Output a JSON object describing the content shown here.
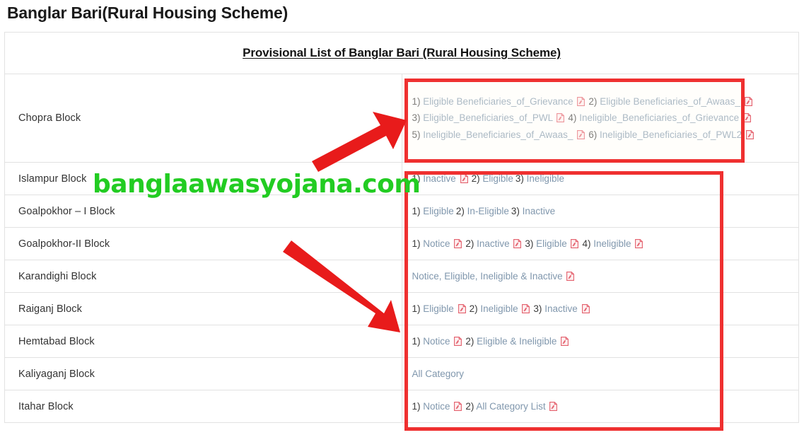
{
  "page": {
    "title": "Banglar Bari(Rural Housing Scheme)",
    "watermark": "banglaawasyojana.com"
  },
  "table": {
    "header": "Provisional List of Banglar Bari (Rural Housing Scheme)",
    "rows": [
      {
        "block": "Chopra Block",
        "lines": [
          [
            {
              "num": "1)",
              "label": "Eligible Beneficiaries_of_Grievance",
              "pdf": true
            },
            {
              "num": "2)",
              "label": "Eligible Beneficiaries_of_Awaas_",
              "pdf": true
            }
          ],
          [
            {
              "num": "3)",
              "label": "Eligible_Beneficiaries_of_PWL",
              "pdf": true
            },
            {
              "num": "4)",
              "label": "Ineligible_Beneficiaries_of_Grievance",
              "pdf": true
            }
          ],
          [
            {
              "num": "5)",
              "label": "Ineligible_Beneficiaries_of_Awaas_",
              "pdf": true
            },
            {
              "num": "6)",
              "label": "Ineligible_Beneficiaries_of_PWL2",
              "pdf": true
            }
          ]
        ]
      },
      {
        "block": "Islampur Block",
        "lines": [
          [
            {
              "num": "1)",
              "label": "Inactive",
              "pdf": true
            },
            {
              "num": "2)",
              "label": "Eligible",
              "pdf": false
            },
            {
              "num": "3)",
              "label": "Ineligible",
              "pdf": false
            }
          ]
        ]
      },
      {
        "block": "Goalpokhor – I Block",
        "lines": [
          [
            {
              "num": "1)",
              "label": "Eligible",
              "pdf": false
            },
            {
              "num": "2)",
              "label": "In-Eligible",
              "pdf": false
            },
            {
              "num": "3)",
              "label": "Inactive",
              "pdf": false
            }
          ]
        ]
      },
      {
        "block": "Goalpokhor-II Block",
        "lines": [
          [
            {
              "num": "1)",
              "label": "Notice",
              "pdf": true
            },
            {
              "num": "2)",
              "label": "Inactive",
              "pdf": true
            },
            {
              "num": "3)",
              "label": "Eligible",
              "pdf": true
            },
            {
              "num": "4)",
              "label": "Ineligible",
              "pdf": true
            }
          ]
        ]
      },
      {
        "block": "Karandighi Block",
        "lines": [
          [
            {
              "num": "",
              "label": "Notice, Eligible, Ineligible & Inactive",
              "pdf": true
            }
          ]
        ]
      },
      {
        "block": "Raiganj Block",
        "lines": [
          [
            {
              "num": "1)",
              "label": "Eligible",
              "pdf": true
            },
            {
              "num": "2)",
              "label": "Ineligible",
              "pdf": true
            },
            {
              "num": "3)",
              "label": "Inactive",
              "pdf": true
            }
          ]
        ]
      },
      {
        "block": "Hemtabad Block",
        "lines": [
          [
            {
              "num": "1)",
              "label": "Notice",
              "pdf": true
            },
            {
              "num": "2)",
              "label": "Eligible & Ineligible",
              "pdf": true
            }
          ]
        ]
      },
      {
        "block": "Kaliyaganj Block",
        "lines": [
          [
            {
              "num": "",
              "label": "All Category",
              "pdf": false
            }
          ]
        ]
      },
      {
        "block": "Itahar Block",
        "lines": [
          [
            {
              "num": "1)",
              "label": "Notice",
              "pdf": true
            },
            {
              "num": "2)",
              "label": "All Category List",
              "pdf": true
            }
          ]
        ]
      }
    ]
  },
  "annotations": {
    "colors": {
      "highlight_box": "#ef3030",
      "arrow": "#e81b1b",
      "link": "#8097ad",
      "watermark": "#22cc22",
      "pdf_icon": "#e4606d"
    },
    "arrows": [
      {
        "name": "arrow-to-chopra-links",
        "direction": "up-right"
      },
      {
        "name": "arrow-to-block-links",
        "direction": "down-right"
      }
    ]
  }
}
